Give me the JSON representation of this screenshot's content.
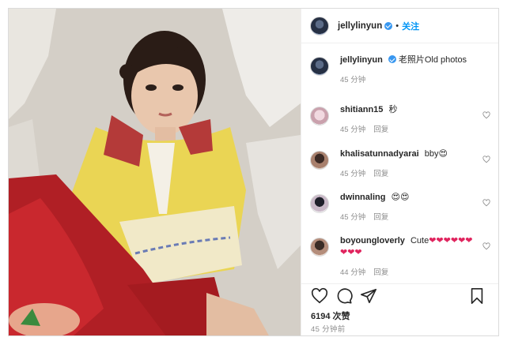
{
  "post": {
    "author": "jellylinyun",
    "follow_label": "关注",
    "separator": "•",
    "caption_text": "老照片Old photos",
    "caption_time": "45 分钟",
    "like_count": "6194 次赞",
    "posted_time": "45 分钟前",
    "photo_description_icon": "photo"
  },
  "comments": [
    {
      "user": "shitiann15",
      "text": "秒",
      "time": "45 分钟",
      "reply": "回复"
    },
    {
      "user": "khalisatunnadyarai",
      "text": "bby😍",
      "time": "45 分钟",
      "reply": "回复"
    },
    {
      "user": "dwinnaling",
      "text": "😍😍",
      "time": "45 分钟",
      "reply": "回复"
    },
    {
      "user": "boyoungloverly",
      "text": "Cute",
      "hearts": "❤❤❤❤❤❤❤❤❤",
      "time": "44 分钟",
      "reply": "回复"
    }
  ],
  "colors": {
    "accent": "#0095f6",
    "heart_red": "#e0245e",
    "muted_text": "#8e8e8e",
    "border": "#dbdbdb"
  },
  "icons": [
    "verified-badge-icon",
    "heart-icon",
    "comment-icon",
    "share-icon",
    "bookmark-icon"
  ]
}
